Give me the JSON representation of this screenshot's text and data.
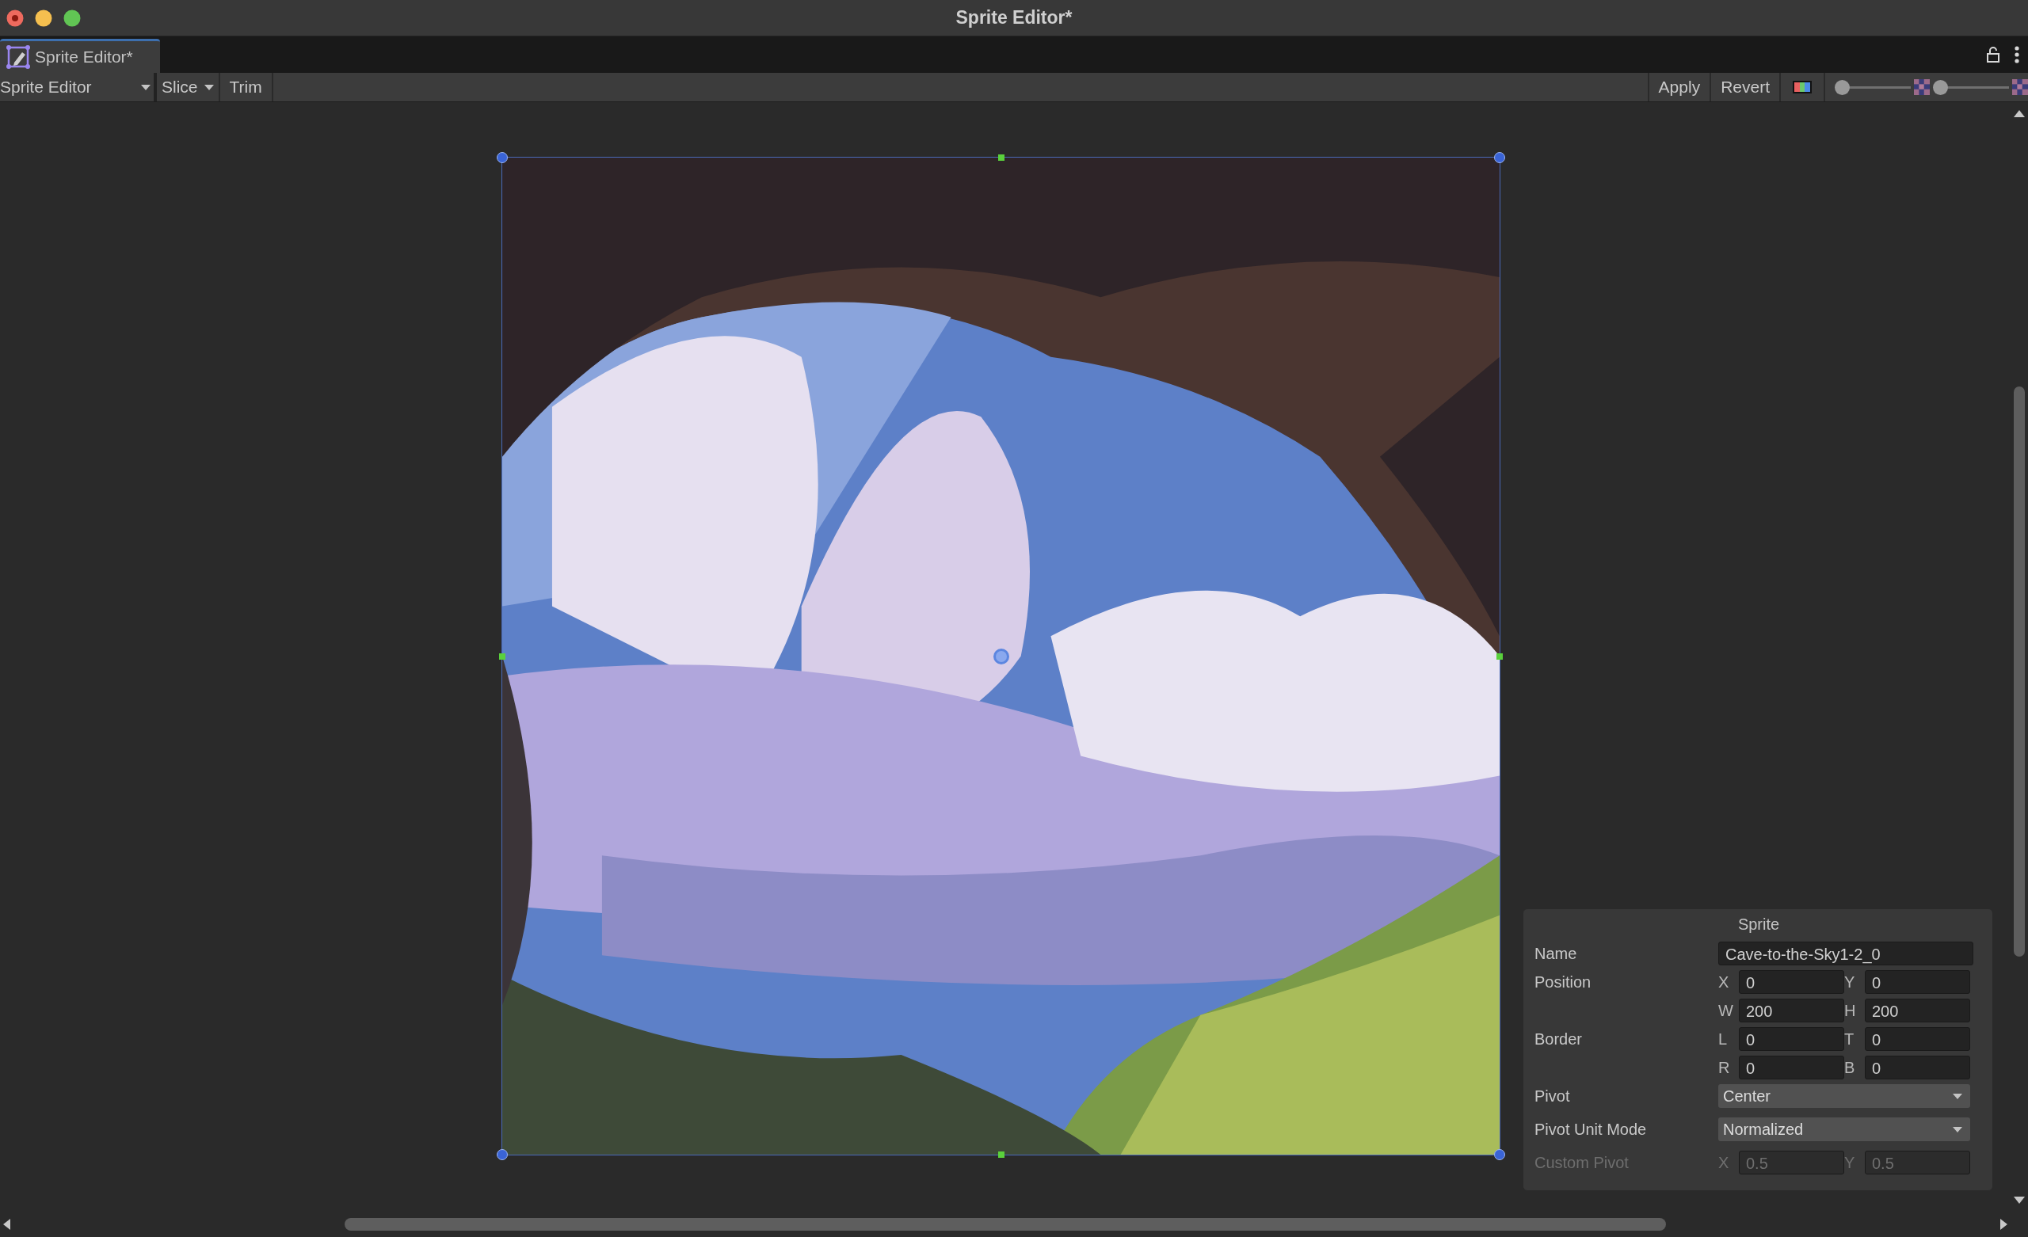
{
  "window": {
    "title": "Sprite Editor*"
  },
  "tab": {
    "label": "Sprite Editor*",
    "selected": true
  },
  "toolbar": {
    "mode_dropdown": "Sprite Editor",
    "left_buttons": [
      {
        "label": "Slice",
        "kind": "dropdown"
      },
      {
        "label": "Trim",
        "kind": "button"
      }
    ],
    "right_buttons": [
      "Apply",
      "Revert"
    ],
    "zoom_slider": {
      "level": 0
    },
    "mip_slider": {
      "level": 0
    }
  },
  "sprite_panel": {
    "title": "Sprite",
    "rows": [
      {
        "kind": "text",
        "label": "Name",
        "value": "Cave-to-the-Sky1-2_0",
        "disabled": false
      },
      {
        "kind": "grid",
        "label": "Position",
        "disabled": false,
        "fields": [
          {
            "axis": "X",
            "value": "0"
          },
          {
            "axis": "Y",
            "value": "0"
          },
          {
            "axis": "W",
            "value": "200"
          },
          {
            "axis": "H",
            "value": "200"
          }
        ]
      },
      {
        "kind": "grid",
        "label": "Border",
        "disabled": false,
        "fields": [
          {
            "axis": "L",
            "value": "0"
          },
          {
            "axis": "T",
            "value": "0"
          },
          {
            "axis": "R",
            "value": "0"
          },
          {
            "axis": "B",
            "value": "0"
          }
        ]
      },
      {
        "kind": "dropdown",
        "label": "Pivot",
        "value": "Center",
        "disabled": false
      },
      {
        "kind": "dropdown",
        "label": "Pivot Unit Mode",
        "value": "Normalized",
        "disabled": false
      },
      {
        "kind": "grid",
        "label": "Custom Pivot",
        "disabled": true,
        "fields": [
          {
            "axis": "X",
            "value": "0.5"
          },
          {
            "axis": "Y",
            "value": "0.5"
          }
        ]
      }
    ]
  }
}
